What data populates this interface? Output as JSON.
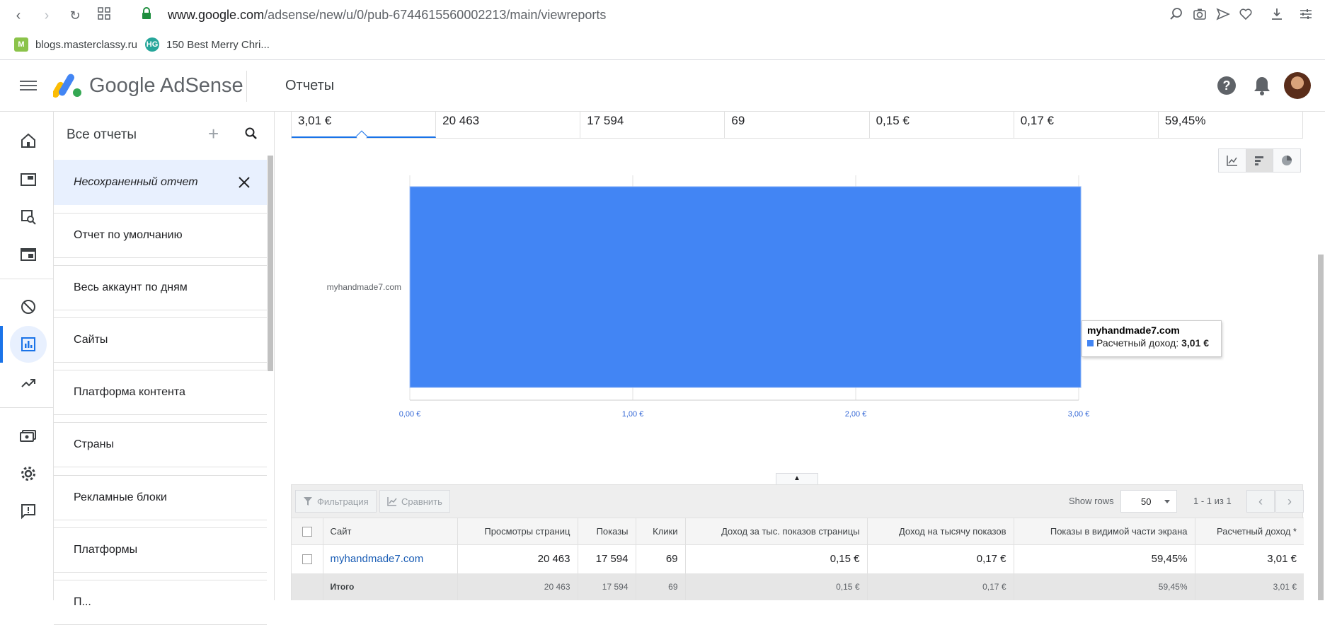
{
  "browser": {
    "url_host": "www.google.com",
    "url_path": "/adsense/new/u/0/pub-6744615560002213/main/viewreports",
    "bookmarks": [
      {
        "label": "blogs.masterclassy.ru",
        "icon": "M",
        "color": "#8bc34a"
      },
      {
        "label": "150 Best Merry Chri...",
        "icon": "HG",
        "color": "#26a69a"
      }
    ]
  },
  "header": {
    "logo": "Google AdSense",
    "page_title": "Отчеты"
  },
  "reports_panel": {
    "title": "Все отчеты",
    "items": [
      {
        "label": "Несохраненный отчет",
        "selected": true
      },
      {
        "label": "Отчет по умолчанию"
      },
      {
        "label": "Весь аккаунт по дням"
      },
      {
        "label": "Сайты"
      },
      {
        "label": "Платформа контента"
      },
      {
        "label": "Страны"
      },
      {
        "label": "Рекламные блоки"
      },
      {
        "label": "Платформы"
      },
      {
        "label": "П..."
      }
    ]
  },
  "metrics": [
    "3,01 €",
    "20 463",
    "17 594",
    "69",
    "0,15 €",
    "0,17 €",
    "59,45%"
  ],
  "chart_data": {
    "type": "bar",
    "orientation": "horizontal",
    "categories": [
      "myhandmade7.com"
    ],
    "series": [
      {
        "name": "Расчетный доход",
        "values": [
          3.01
        ]
      }
    ],
    "xlim": [
      0,
      3
    ],
    "x_ticks": [
      "0,00 €",
      "1,00 €",
      "2,00 €",
      "3,00 €"
    ],
    "color": "#4285f4",
    "grid": true
  },
  "tooltip": {
    "title": "myhandmade7.com",
    "label": "Расчетный доход:",
    "value": "3,01 €"
  },
  "table": {
    "toolbar": {
      "filter": "Фильтрация",
      "compare": "Сравнить",
      "show_rows": "Show rows",
      "rows_value": "50",
      "pager": "1 - 1 из 1"
    },
    "columns": [
      "Сайт",
      "Просмотры страниц",
      "Показы",
      "Клики",
      "Доход за тыс. показов страницы",
      "Доход на тысячу показов",
      "Показы в видимой части экрана",
      "Расчетный доход *"
    ],
    "row": [
      "myhandmade7.com",
      "20 463",
      "17 594",
      "69",
      "0,15 €",
      "0,17 €",
      "59,45%",
      "3,01 €"
    ],
    "total": [
      "Итого",
      "20 463",
      "17 594",
      "69",
      "0,15 €",
      "0,17 €",
      "59,45%",
      "3,01 €"
    ]
  }
}
